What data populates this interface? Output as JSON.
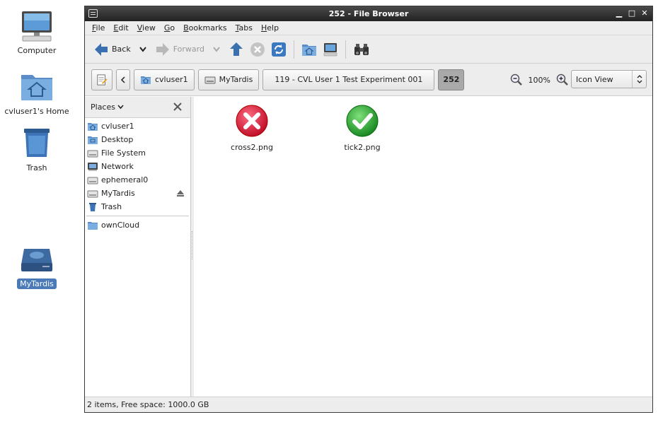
{
  "desktop": {
    "icons": [
      {
        "label": "Computer"
      },
      {
        "label": "cvluser1's Home"
      },
      {
        "label": "Trash"
      },
      {
        "label": "MyTardis"
      }
    ]
  },
  "window": {
    "title": "252 - File Browser"
  },
  "menubar": {
    "items": [
      {
        "label": "File",
        "accel": "F",
        "rest": "ile"
      },
      {
        "label": "Edit",
        "accel": "E",
        "rest": "dit"
      },
      {
        "label": "View",
        "accel": "V",
        "rest": "iew"
      },
      {
        "label": "Go",
        "accel": "G",
        "rest": "o"
      },
      {
        "label": "Bookmarks",
        "accel": "B",
        "rest": "ookmarks"
      },
      {
        "label": "Tabs",
        "accel": "T",
        "rest": "abs"
      },
      {
        "label": "Help",
        "accel": "H",
        "rest": "elp"
      }
    ]
  },
  "toolbar": {
    "back_label": "Back",
    "forward_label": "Forward"
  },
  "location": {
    "crumbs": [
      {
        "label": "cvluser1"
      },
      {
        "label": "MyTardis"
      },
      {
        "label": "119 - CVL User 1 Test Experiment 001"
      },
      {
        "label": "252"
      }
    ],
    "zoom_level": "100%",
    "view_mode": "Icon View"
  },
  "sidebar": {
    "header": "Places",
    "items": [
      {
        "label": "cvluser1"
      },
      {
        "label": "Desktop"
      },
      {
        "label": "File System"
      },
      {
        "label": "Network"
      },
      {
        "label": "ephemeral0"
      },
      {
        "label": "MyTardis"
      },
      {
        "label": "Trash"
      }
    ],
    "bookmarks": [
      {
        "label": "ownCloud"
      }
    ]
  },
  "files": [
    {
      "name": "cross2.png",
      "icon": "cross-icon"
    },
    {
      "name": "tick2.png",
      "icon": "tick-icon"
    }
  ],
  "status": {
    "text": "2 items, Free space: 1000.0 GB"
  },
  "colors": {
    "accent": "#4a7ab8",
    "cross": "#e0203a",
    "tick": "#2fb53a"
  }
}
